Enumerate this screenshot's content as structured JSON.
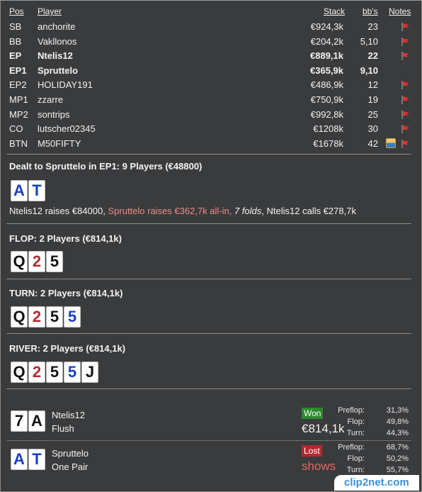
{
  "columns": {
    "pos": "Pos",
    "player": "Player",
    "stack": "Stack",
    "bbs": "bb's",
    "notes": "Notes"
  },
  "players": [
    {
      "pos": "SB",
      "name": "anchorite",
      "stack": "€924,3k",
      "bbs": "23",
      "bold": false,
      "flag": true,
      "avatar": false
    },
    {
      "pos": "BB",
      "name": "Vakllonos",
      "stack": "€204,2k",
      "bbs": "5,10",
      "bold": false,
      "flag": true,
      "avatar": false
    },
    {
      "pos": "EP",
      "name": "Ntelis12",
      "stack": "€889,1k",
      "bbs": "22",
      "bold": true,
      "flag": true,
      "avatar": false
    },
    {
      "pos": "EP1",
      "name": "Spruttelo",
      "stack": "€365,9k",
      "bbs": "9,10",
      "bold": true,
      "flag": false,
      "avatar": false
    },
    {
      "pos": "EP2",
      "name": "HOLIDAY191",
      "stack": "€486,9k",
      "bbs": "12",
      "bold": false,
      "flag": true,
      "avatar": false
    },
    {
      "pos": "MP1",
      "name": "zzarre",
      "stack": "€750,9k",
      "bbs": "19",
      "bold": false,
      "flag": true,
      "avatar": false
    },
    {
      "pos": "MP2",
      "name": "sontrips",
      "stack": "€992,8k",
      "bbs": "25",
      "bold": false,
      "flag": true,
      "avatar": false
    },
    {
      "pos": "CO",
      "name": "lutscher02345",
      "stack": "€1208k",
      "bbs": "30",
      "bold": false,
      "flag": true,
      "avatar": false
    },
    {
      "pos": "BTN",
      "name": "M50FIFTY",
      "stack": "€1678k",
      "bbs": "42",
      "bold": false,
      "flag": true,
      "avatar": true
    }
  ],
  "dealt": {
    "title": "Dealt to Spruttelo in EP1: 9 Players (€48800)",
    "cards": [
      {
        "rank": "A",
        "suit": "d"
      },
      {
        "rank": "T",
        "suit": "d"
      }
    ],
    "action_1": "Ntelis12 raises €84000, ",
    "action_2": "Spruttelo raises €362,7k all-in, ",
    "action_3": "7 folds",
    "action_4": ", Ntelis12 calls €278,7k"
  },
  "flop": {
    "title": "FLOP: 2 Players (€814,1k)",
    "cards": [
      {
        "rank": "Q",
        "suit": "s"
      },
      {
        "rank": "2",
        "suit": "h"
      },
      {
        "rank": "5",
        "suit": "s"
      }
    ]
  },
  "turn": {
    "title": "TURN: 2 Players (€814,1k)",
    "cards": [
      {
        "rank": "Q",
        "suit": "s"
      },
      {
        "rank": "2",
        "suit": "h"
      },
      {
        "rank": "5",
        "suit": "s"
      },
      {
        "rank": "5",
        "suit": "d"
      }
    ]
  },
  "river": {
    "title": "RIVER: 2 Players (€814,1k)",
    "cards": [
      {
        "rank": "Q",
        "suit": "s"
      },
      {
        "rank": "2",
        "suit": "h"
      },
      {
        "rank": "5",
        "suit": "s"
      },
      {
        "rank": "5",
        "suit": "d"
      },
      {
        "rank": "J",
        "suit": "s"
      }
    ]
  },
  "results": [
    {
      "cards": [
        {
          "rank": "7",
          "suit": "s"
        },
        {
          "rank": "A",
          "suit": "s"
        }
      ],
      "name": "Ntelis12",
      "hand": "Flush",
      "badge": "Won",
      "badge_type": "won",
      "amount": "€814,1k",
      "equity": [
        {
          "label": "Preflop:",
          "value": "31,3%"
        },
        {
          "label": "Flop:",
          "value": "49,8%"
        },
        {
          "label": "Turn:",
          "value": "44,3%"
        }
      ]
    },
    {
      "cards": [
        {
          "rank": "A",
          "suit": "d"
        },
        {
          "rank": "T",
          "suit": "d"
        }
      ],
      "name": "Spruttelo",
      "hand": "One Pair",
      "badge": "Lost",
      "badge_type": "lost",
      "amount": "shows",
      "equity": [
        {
          "label": "Preflop:",
          "value": "68,7%"
        },
        {
          "label": "Flop:",
          "value": "50,2%"
        },
        {
          "label": "Turn:",
          "value": "55,7%"
        }
      ]
    }
  ],
  "watermark": "clip2net.com",
  "colors": {
    "background": "#3a3b3d",
    "hero_action": "#e98e86",
    "won": "#2b8a2f",
    "lost": "#b9272c",
    "flag": "#d9342b"
  }
}
